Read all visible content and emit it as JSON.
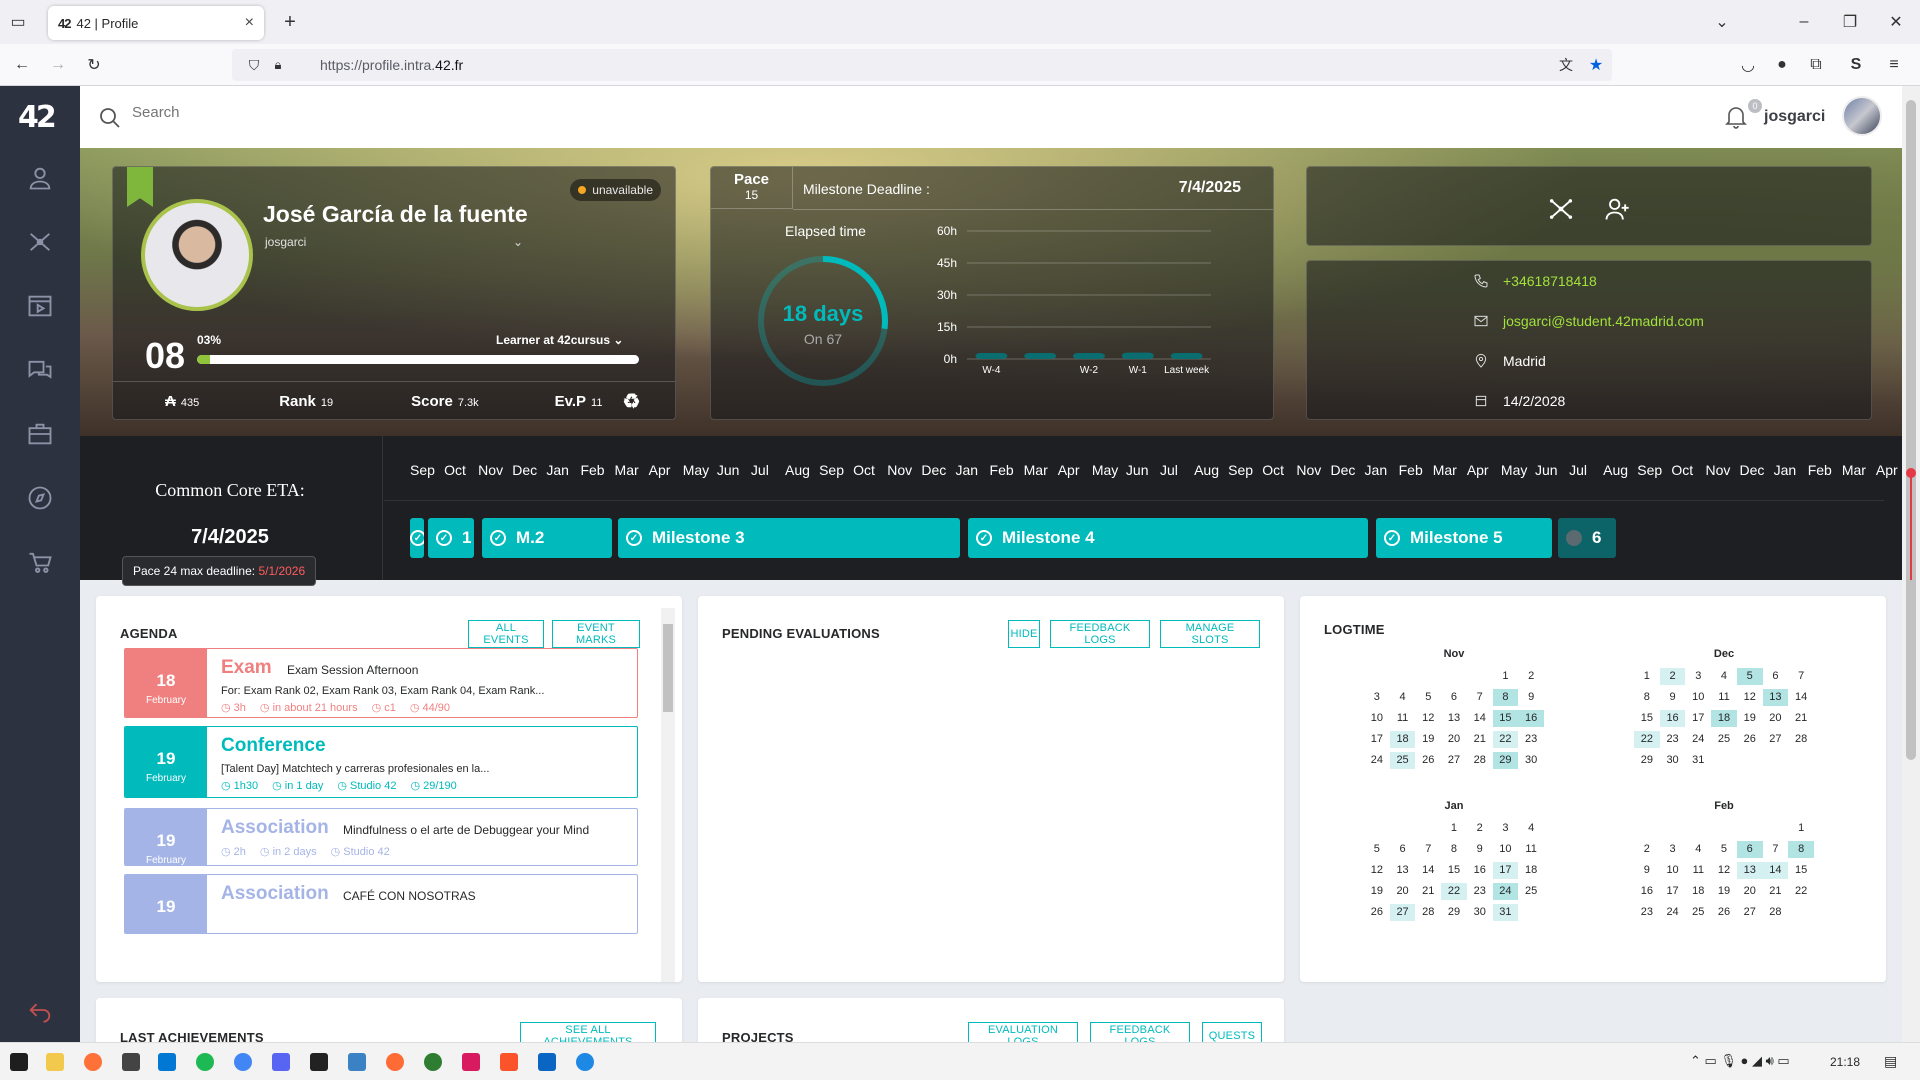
{
  "browser": {
    "tab_title": "42 | Profile",
    "tab_favicon": "42",
    "url_prefix": "https://profile.intra.",
    "url_domain": "42.fr"
  },
  "header": {
    "search_placeholder": "Search",
    "notification_count": "0",
    "login": "josgarci"
  },
  "profile": {
    "status": "unavailable",
    "full_name": "José García de la fuente",
    "login": "josgarci",
    "level": "08",
    "level_percent": "03%",
    "level_progress": 0.03,
    "cursus": "Learner at 42cursus",
    "wallet": "435",
    "rank_label": "Rank",
    "rank_value": "19",
    "score_label": "Score",
    "score_value": "7.3k",
    "evp_label": "Ev.P",
    "evp_value": "11"
  },
  "milestone": {
    "pace_label": "Pace",
    "pace_value": "15",
    "deadline_label": "Milestone Deadline :",
    "deadline_date": "7/4/2025",
    "elapsed_label": "Elapsed time",
    "elapsed_days": "18 days",
    "elapsed_total": "On 67",
    "elapsed_fraction": 0.27
  },
  "chart_data": {
    "type": "bar",
    "categories": [
      "W-4",
      "W-3",
      "W-2",
      "W-1",
      "Last week"
    ],
    "category_labels": [
      "W-4",
      "",
      "W-2",
      "W-1",
      "Last week"
    ],
    "values": [
      1.5,
      1.5,
      1.5,
      3,
      1.5
    ],
    "ytick_labels": [
      "60h",
      "45h",
      "30h",
      "15h",
      "0h"
    ],
    "yticks": [
      60,
      45,
      30,
      15,
      0
    ],
    "ylim": [
      0,
      60
    ],
    "grid": true
  },
  "contact": {
    "phone": "+34618718418",
    "email": "josgarci@student.42madrid.com",
    "campus": "Madrid",
    "date": "14/2/2028"
  },
  "timeline": {
    "eta_label": "Common Core ETA:",
    "eta_date": "7/4/2025",
    "pace_deadline_label": "Pace 24 max deadline:",
    "pace_deadline_date": "5/1/2026",
    "months": [
      "Sep",
      "Oct",
      "Nov",
      "Dec",
      "Jan",
      "Feb",
      "Mar",
      "Apr",
      "May",
      "Jun",
      "Jul",
      "Aug",
      "Sep",
      "Oct",
      "Nov",
      "Dec",
      "Jan",
      "Feb",
      "Mar",
      "Apr",
      "May",
      "Jun",
      "Jul",
      "Aug",
      "Sep",
      "Oct",
      "Nov",
      "Dec",
      "Jan",
      "Feb",
      "Mar",
      "Apr",
      "May",
      "Jun",
      "Jul",
      "Aug",
      "Sep",
      "Oct",
      "Nov",
      "Dec",
      "Jan",
      "Feb",
      "Mar",
      "Apr"
    ],
    "milestones": [
      {
        "label": "",
        "done": true
      },
      {
        "label": "1",
        "done": true
      },
      {
        "label": "M.2",
        "done": true
      },
      {
        "label": "Milestone 3",
        "done": true
      },
      {
        "label": "Milestone 4",
        "done": true
      },
      {
        "label": "Milestone 5",
        "done": true
      },
      {
        "label": "6",
        "done": false
      }
    ]
  },
  "agenda": {
    "title": "AGENDA",
    "btn_all_events": "ALL EVENTS",
    "btn_event_marks": "EVENT MARKS",
    "events": [
      {
        "day": "18",
        "month": "February",
        "kind": "Exam",
        "name": "Exam Session Afternoon",
        "desc": "For: Exam Rank 02, Exam Rank 03, Exam Rank 04, Exam Rank...",
        "duration": "3h",
        "when": "in about 21 hours",
        "place": "c1",
        "seats": "44/90",
        "color": "#f08080"
      },
      {
        "day": "19",
        "month": "February",
        "kind": "Conference",
        "name": "",
        "desc": "[Talent Day] Matchtech y carreras profesionales en la...",
        "duration": "1h30",
        "when": "in 1 day",
        "place": "Studio 42",
        "seats": "29/190",
        "color": "#00babc"
      },
      {
        "day": "19",
        "month": "February",
        "kind": "Association",
        "name": "Mindfulness o el arte de Debuggear your Mind",
        "desc": "",
        "duration": "2h",
        "when": "in 2 days",
        "place": "Studio 42",
        "seats": "",
        "color": "#a5b4e6"
      },
      {
        "day": "19",
        "month": "",
        "kind": "Association",
        "name": "CAFÉ CON NOSOTRAS",
        "desc": "",
        "duration": "",
        "when": "",
        "place": "",
        "seats": "",
        "color": "#a5b4e6"
      }
    ]
  },
  "evaluations": {
    "title": "PENDING EVALUATIONS",
    "btn_hide": "HIDE",
    "btn_feedback": "FEEDBACK LOGS",
    "btn_slots": "MANAGE SLOTS"
  },
  "logtime": {
    "title": "LOGTIME",
    "months": [
      {
        "name": "Nov",
        "offset": 5,
        "days": 30,
        "l1": [
          18,
          22,
          25
        ],
        "l2": [
          8,
          15,
          16,
          29
        ]
      },
      {
        "name": "Dec",
        "offset": 0,
        "days": 31,
        "l1": [
          2,
          16,
          22
        ],
        "l2": [
          5,
          13,
          18
        ]
      },
      {
        "name": "Jan",
        "offset": 3,
        "days": 31,
        "l1": [
          17,
          22,
          27,
          31
        ],
        "l2": [
          24
        ]
      },
      {
        "name": "Feb",
        "offset": 6,
        "days": 28,
        "l1": [
          13,
          14
        ],
        "l2": [
          6,
          8
        ]
      }
    ]
  },
  "bottom": {
    "achievements_title": "LAST ACHIEVEMENTS",
    "btn_see_all": "SEE ALL ACHIEVEMENTS",
    "projects_title": "PROJECTS",
    "btn_eval_logs": "EVALUATION LOGS",
    "btn_feedback_logs": "FEEDBACK LOGS",
    "btn_quests": "QUESTS"
  },
  "taskbar": {
    "time": "21:18"
  }
}
